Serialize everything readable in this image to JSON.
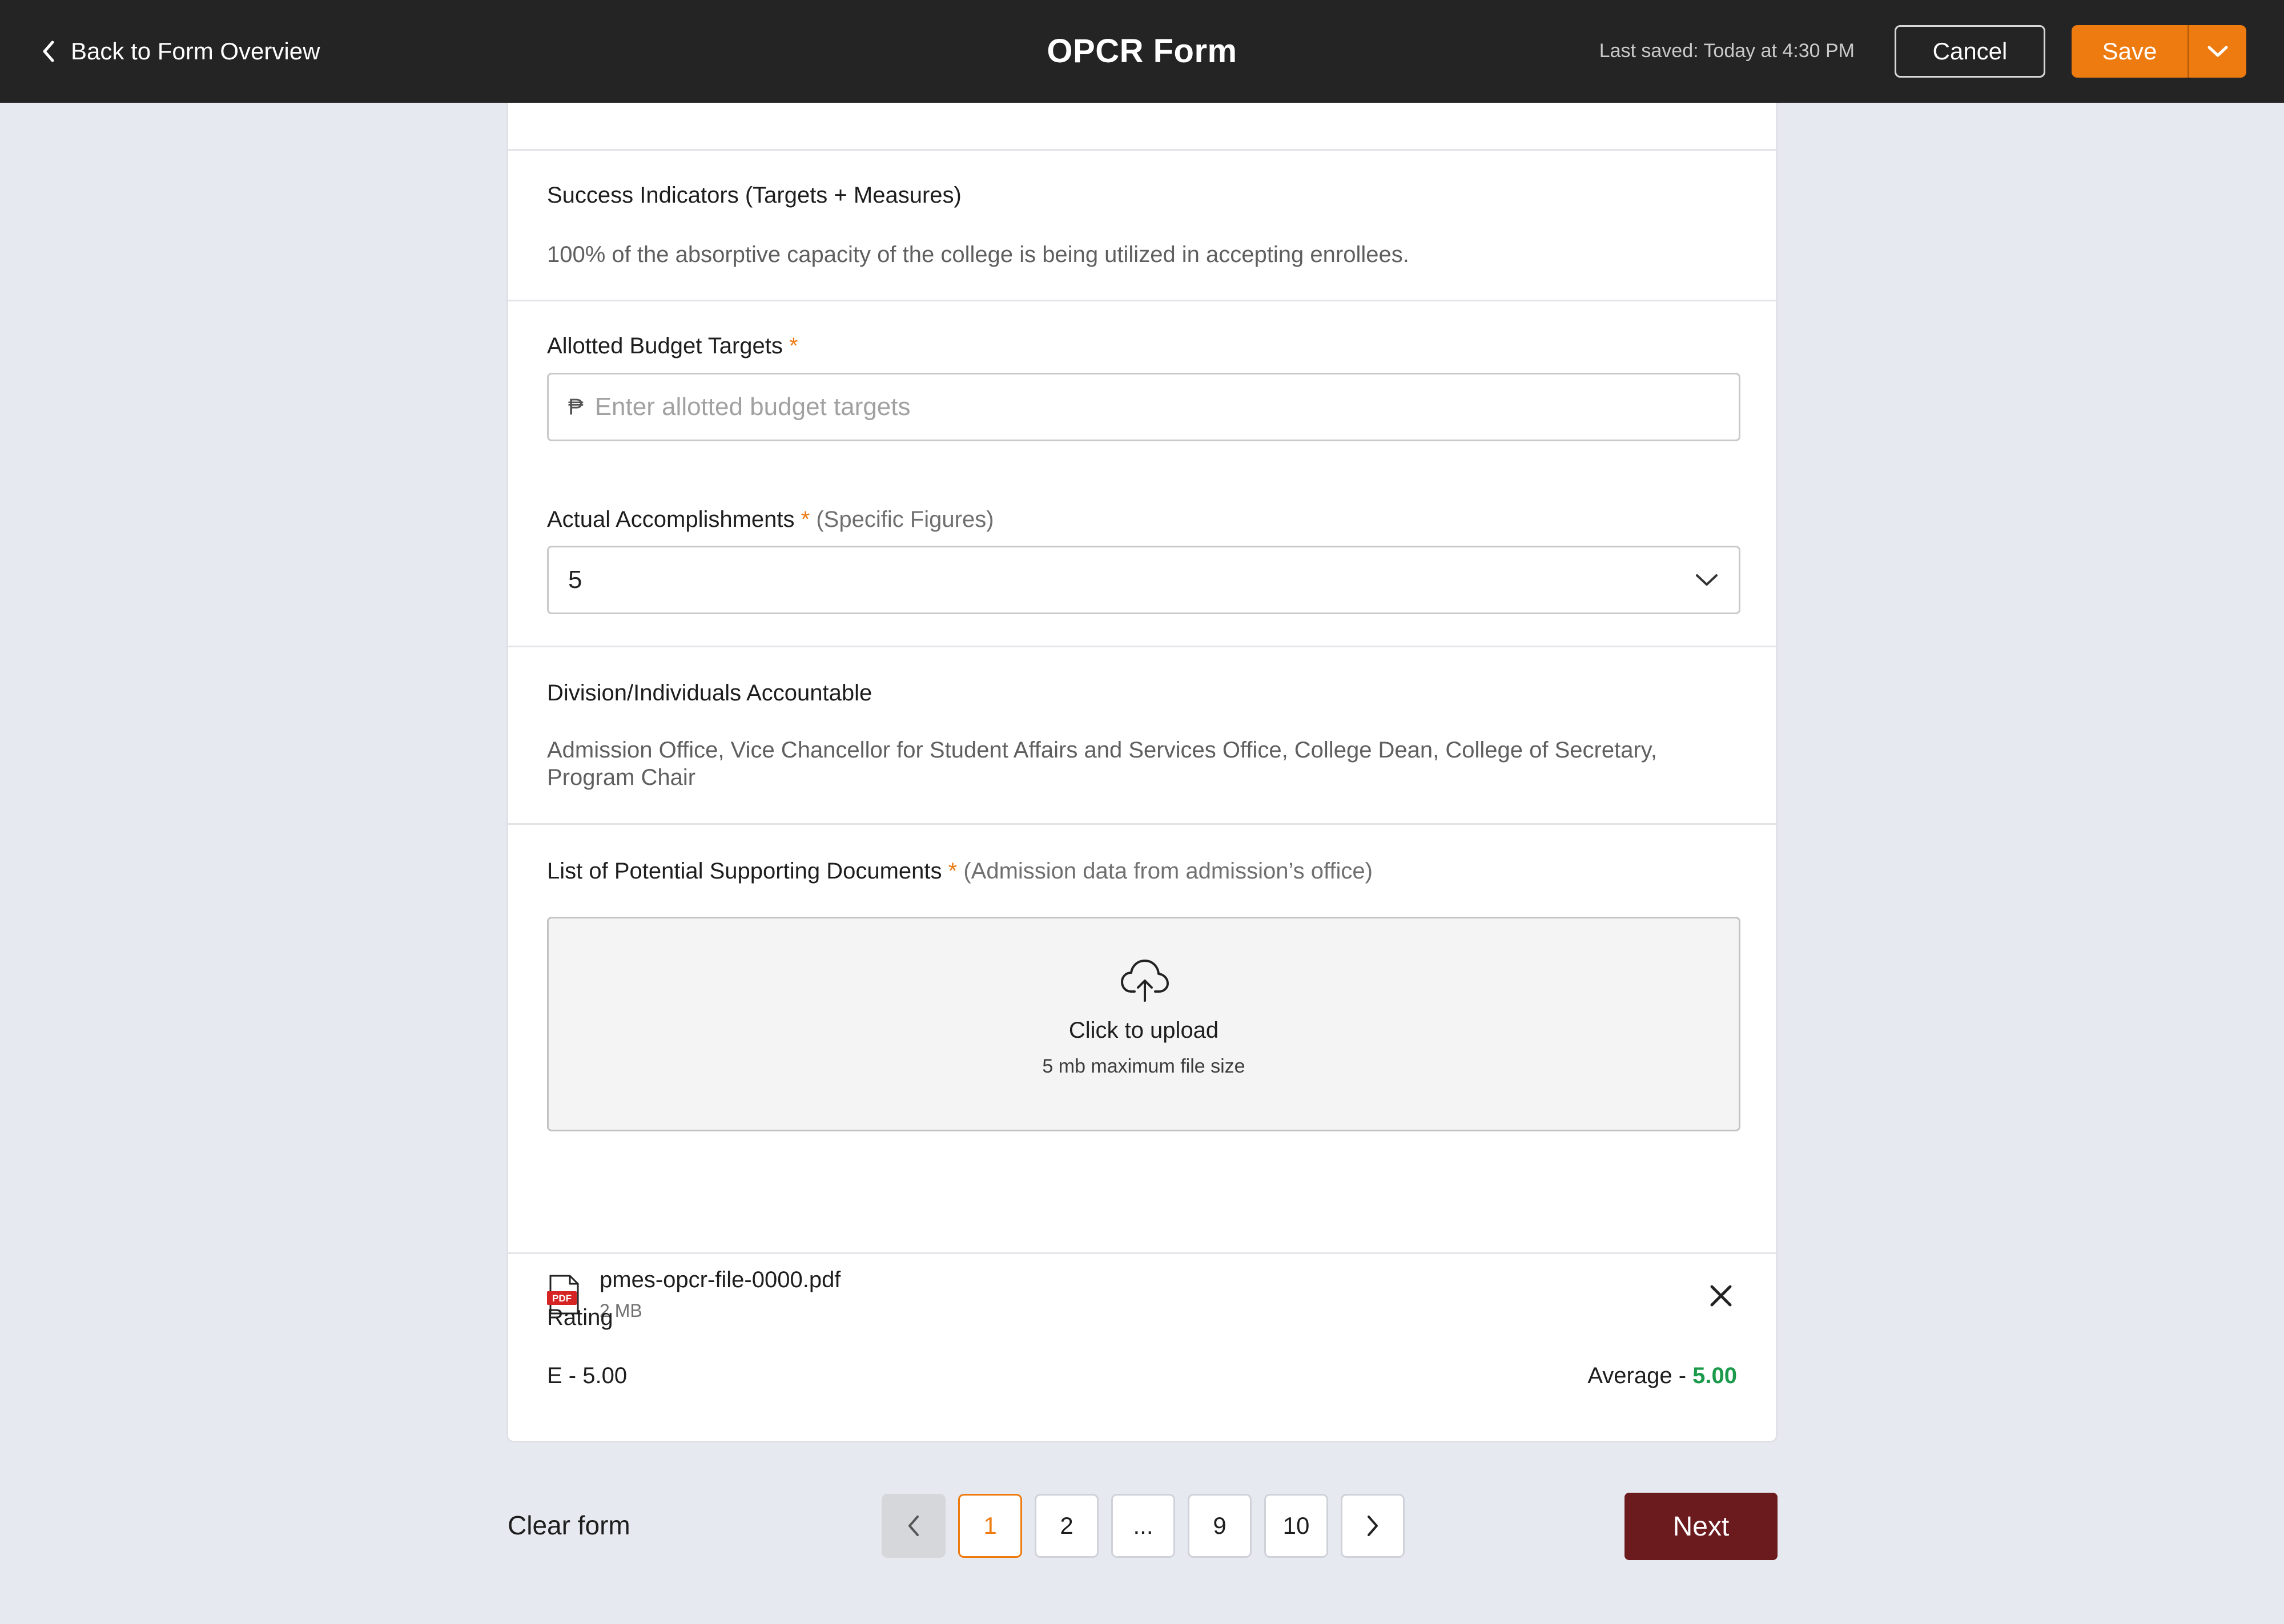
{
  "header": {
    "back_label": "Back to Form Overview",
    "title": "OPCR Form",
    "last_saved": "Last saved: Today at 4:30 PM",
    "cancel_label": "Cancel",
    "save_label": "Save"
  },
  "form": {
    "success_indicators": {
      "label": "Success Indicators (Targets + Measures)",
      "value": "100% of the absorptive capacity of the college is being utilized in accepting enrollees."
    },
    "allotted_budget": {
      "label": "Allotted Budget Targets",
      "required_mark": "*",
      "currency_symbol": "₱",
      "placeholder": "Enter allotted budget targets",
      "value": ""
    },
    "actual_accomplishments": {
      "label": "Actual Accomplishments",
      "required_mark": "*",
      "hint": "(Specific Figures)",
      "selected": "5"
    },
    "division_accountable": {
      "label": "Division/Individuals Accountable",
      "value": "Admission Office, Vice Chancellor for Student Affairs and Services Office, College Dean, College of Secretary, Program Chair"
    },
    "supporting_documents": {
      "label": "List of Potential Supporting Documents",
      "required_mark": "*",
      "hint": "(Admission data from admission’s office)",
      "upload_title": "Click to upload",
      "upload_subtitle": "5 mb maximum file size",
      "file": {
        "name": "pmes-opcr-file-0000.pdf",
        "size": "2 MB",
        "icon_badge": "PDF"
      }
    },
    "rating": {
      "label": "Rating",
      "value": "E - 5.00",
      "average_label": "Average - ",
      "average_value": "5.00"
    }
  },
  "footer": {
    "clear_label": "Clear form",
    "pages": [
      "1",
      "2",
      "...",
      "9",
      "10"
    ],
    "active_page": "1",
    "next_label": "Next"
  },
  "colors": {
    "accent": "#ee7b10",
    "next_button": "#6b1a1e",
    "average_value": "#1a9a4a",
    "topbar": "#242424"
  }
}
